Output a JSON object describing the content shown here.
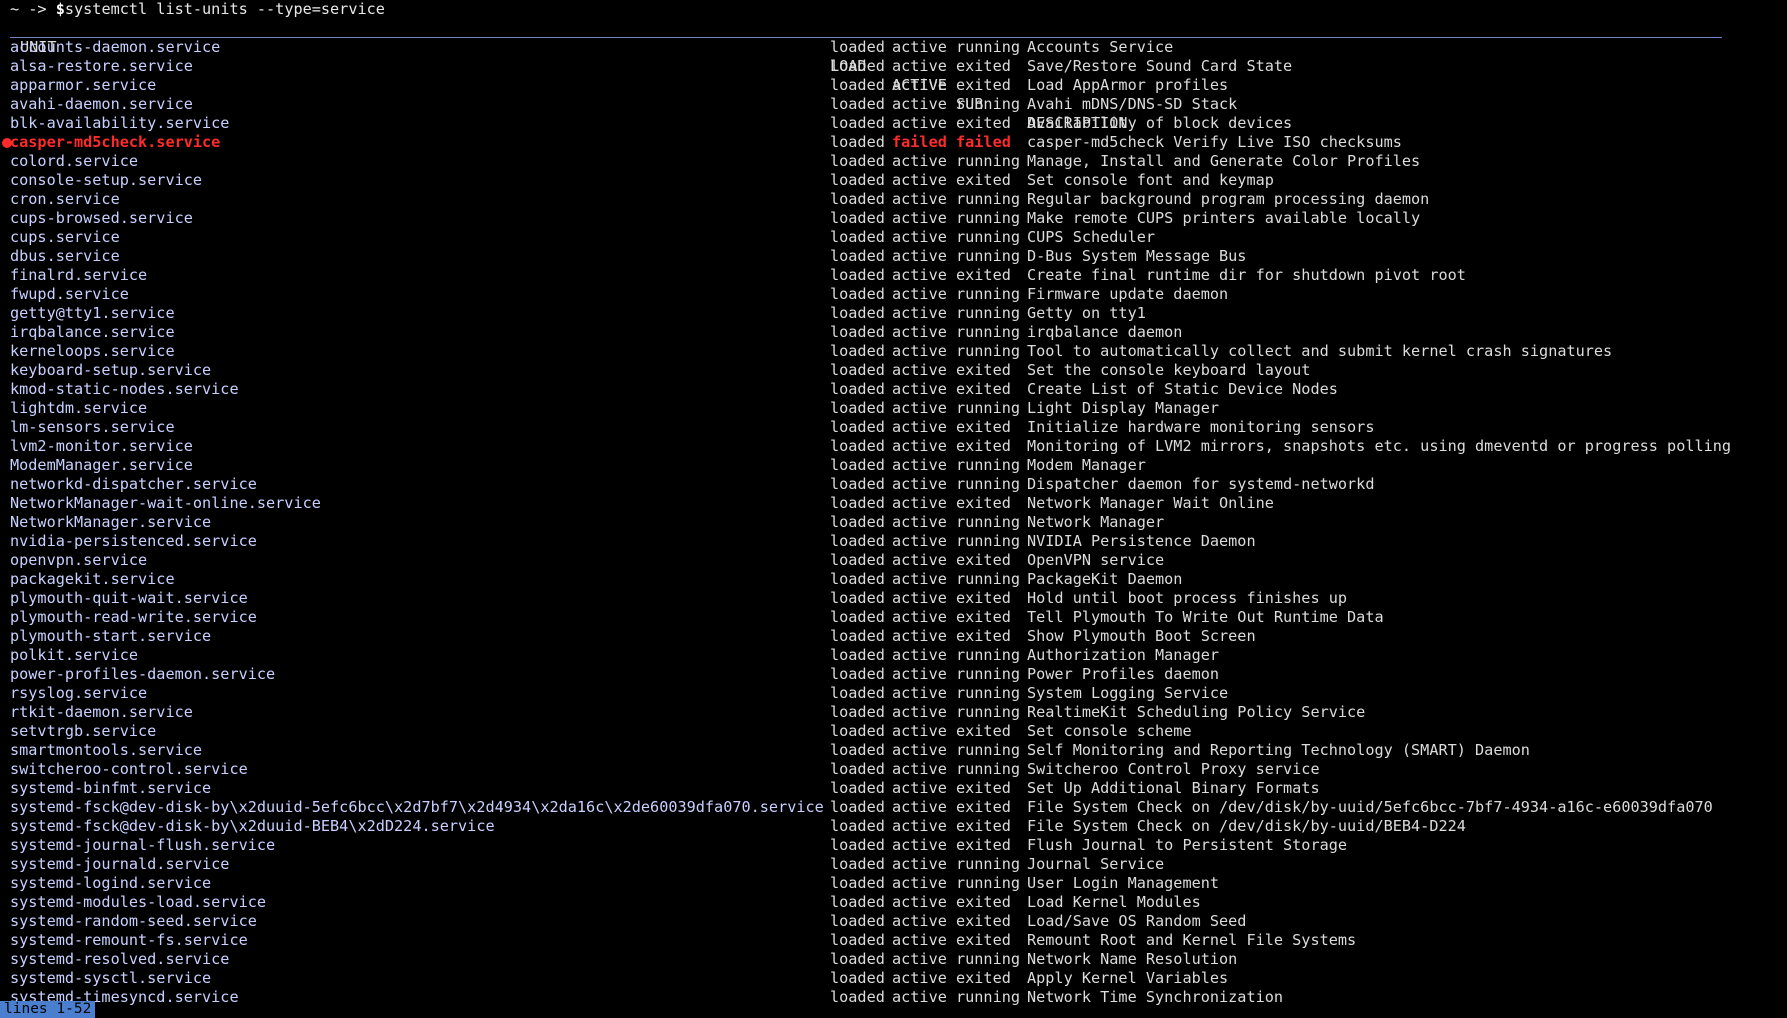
{
  "prompt": {
    "prefix": "~ -> ",
    "symbol": "$",
    "command": "systemctl list-units --type=service"
  },
  "columns": {
    "unit": "UNIT",
    "load": "LOAD",
    "active": "ACTIVE",
    "sub": "SUB",
    "description": "DESCRIPTION"
  },
  "rows": [
    {
      "unit": "accounts-daemon.service",
      "load": "loaded",
      "active": "active",
      "sub": "running",
      "description": "Accounts Service"
    },
    {
      "unit": "alsa-restore.service",
      "load": "loaded",
      "active": "active",
      "sub": "exited",
      "description": "Save/Restore Sound Card State"
    },
    {
      "unit": "apparmor.service",
      "load": "loaded",
      "active": "active",
      "sub": "exited",
      "description": "Load AppArmor profiles"
    },
    {
      "unit": "avahi-daemon.service",
      "load": "loaded",
      "active": "active",
      "sub": "running",
      "description": "Avahi mDNS/DNS-SD Stack"
    },
    {
      "unit": "blk-availability.service",
      "load": "loaded",
      "active": "active",
      "sub": "exited",
      "description": "Availability of block devices"
    },
    {
      "unit": "casper-md5check.service",
      "load": "loaded",
      "active": "failed",
      "sub": "failed",
      "description": "casper-md5check Verify Live ISO checksums",
      "failed": true
    },
    {
      "unit": "colord.service",
      "load": "loaded",
      "active": "active",
      "sub": "running",
      "description": "Manage, Install and Generate Color Profiles"
    },
    {
      "unit": "console-setup.service",
      "load": "loaded",
      "active": "active",
      "sub": "exited",
      "description": "Set console font and keymap"
    },
    {
      "unit": "cron.service",
      "load": "loaded",
      "active": "active",
      "sub": "running",
      "description": "Regular background program processing daemon"
    },
    {
      "unit": "cups-browsed.service",
      "load": "loaded",
      "active": "active",
      "sub": "running",
      "description": "Make remote CUPS printers available locally"
    },
    {
      "unit": "cups.service",
      "load": "loaded",
      "active": "active",
      "sub": "running",
      "description": "CUPS Scheduler"
    },
    {
      "unit": "dbus.service",
      "load": "loaded",
      "active": "active",
      "sub": "running",
      "description": "D-Bus System Message Bus"
    },
    {
      "unit": "finalrd.service",
      "load": "loaded",
      "active": "active",
      "sub": "exited",
      "description": "Create final runtime dir for shutdown pivot root"
    },
    {
      "unit": "fwupd.service",
      "load": "loaded",
      "active": "active",
      "sub": "running",
      "description": "Firmware update daemon"
    },
    {
      "unit": "getty@tty1.service",
      "load": "loaded",
      "active": "active",
      "sub": "running",
      "description": "Getty on tty1"
    },
    {
      "unit": "irqbalance.service",
      "load": "loaded",
      "active": "active",
      "sub": "running",
      "description": "irqbalance daemon"
    },
    {
      "unit": "kerneloops.service",
      "load": "loaded",
      "active": "active",
      "sub": "running",
      "description": "Tool to automatically collect and submit kernel crash signatures"
    },
    {
      "unit": "keyboard-setup.service",
      "load": "loaded",
      "active": "active",
      "sub": "exited",
      "description": "Set the console keyboard layout"
    },
    {
      "unit": "kmod-static-nodes.service",
      "load": "loaded",
      "active": "active",
      "sub": "exited",
      "description": "Create List of Static Device Nodes"
    },
    {
      "unit": "lightdm.service",
      "load": "loaded",
      "active": "active",
      "sub": "running",
      "description": "Light Display Manager"
    },
    {
      "unit": "lm-sensors.service",
      "load": "loaded",
      "active": "active",
      "sub": "exited",
      "description": "Initialize hardware monitoring sensors"
    },
    {
      "unit": "lvm2-monitor.service",
      "load": "loaded",
      "active": "active",
      "sub": "exited",
      "description": "Monitoring of LVM2 mirrors, snapshots etc. using dmeventd or progress polling"
    },
    {
      "unit": "ModemManager.service",
      "load": "loaded",
      "active": "active",
      "sub": "running",
      "description": "Modem Manager"
    },
    {
      "unit": "networkd-dispatcher.service",
      "load": "loaded",
      "active": "active",
      "sub": "running",
      "description": "Dispatcher daemon for systemd-networkd"
    },
    {
      "unit": "NetworkManager-wait-online.service",
      "load": "loaded",
      "active": "active",
      "sub": "exited",
      "description": "Network Manager Wait Online"
    },
    {
      "unit": "NetworkManager.service",
      "load": "loaded",
      "active": "active",
      "sub": "running",
      "description": "Network Manager"
    },
    {
      "unit": "nvidia-persistenced.service",
      "load": "loaded",
      "active": "active",
      "sub": "running",
      "description": "NVIDIA Persistence Daemon"
    },
    {
      "unit": "openvpn.service",
      "load": "loaded",
      "active": "active",
      "sub": "exited",
      "description": "OpenVPN service"
    },
    {
      "unit": "packagekit.service",
      "load": "loaded",
      "active": "active",
      "sub": "running",
      "description": "PackageKit Daemon"
    },
    {
      "unit": "plymouth-quit-wait.service",
      "load": "loaded",
      "active": "active",
      "sub": "exited",
      "description": "Hold until boot process finishes up"
    },
    {
      "unit": "plymouth-read-write.service",
      "load": "loaded",
      "active": "active",
      "sub": "exited",
      "description": "Tell Plymouth To Write Out Runtime Data"
    },
    {
      "unit": "plymouth-start.service",
      "load": "loaded",
      "active": "active",
      "sub": "exited",
      "description": "Show Plymouth Boot Screen"
    },
    {
      "unit": "polkit.service",
      "load": "loaded",
      "active": "active",
      "sub": "running",
      "description": "Authorization Manager"
    },
    {
      "unit": "power-profiles-daemon.service",
      "load": "loaded",
      "active": "active",
      "sub": "running",
      "description": "Power Profiles daemon"
    },
    {
      "unit": "rsyslog.service",
      "load": "loaded",
      "active": "active",
      "sub": "running",
      "description": "System Logging Service"
    },
    {
      "unit": "rtkit-daemon.service",
      "load": "loaded",
      "active": "active",
      "sub": "running",
      "description": "RealtimeKit Scheduling Policy Service"
    },
    {
      "unit": "setvtrgb.service",
      "load": "loaded",
      "active": "active",
      "sub": "exited",
      "description": "Set console scheme"
    },
    {
      "unit": "smartmontools.service",
      "load": "loaded",
      "active": "active",
      "sub": "running",
      "description": "Self Monitoring and Reporting Technology (SMART) Daemon"
    },
    {
      "unit": "switcheroo-control.service",
      "load": "loaded",
      "active": "active",
      "sub": "running",
      "description": "Switcheroo Control Proxy service"
    },
    {
      "unit": "systemd-binfmt.service",
      "load": "loaded",
      "active": "active",
      "sub": "exited",
      "description": "Set Up Additional Binary Formats"
    },
    {
      "unit": "systemd-fsck@dev-disk-by\\x2duuid-5efc6bcc\\x2d7bf7\\x2d4934\\x2da16c\\x2de60039dfa070.service",
      "load": "loaded",
      "active": "active",
      "sub": "exited",
      "description": "File System Check on /dev/disk/by-uuid/5efc6bcc-7bf7-4934-a16c-e60039dfa070"
    },
    {
      "unit": "systemd-fsck@dev-disk-by\\x2duuid-BEB4\\x2dD224.service",
      "load": "loaded",
      "active": "active",
      "sub": "exited",
      "description": "File System Check on /dev/disk/by-uuid/BEB4-D224"
    },
    {
      "unit": "systemd-journal-flush.service",
      "load": "loaded",
      "active": "active",
      "sub": "exited",
      "description": "Flush Journal to Persistent Storage"
    },
    {
      "unit": "systemd-journald.service",
      "load": "loaded",
      "active": "active",
      "sub": "running",
      "description": "Journal Service"
    },
    {
      "unit": "systemd-logind.service",
      "load": "loaded",
      "active": "active",
      "sub": "running",
      "description": "User Login Management"
    },
    {
      "unit": "systemd-modules-load.service",
      "load": "loaded",
      "active": "active",
      "sub": "exited",
      "description": "Load Kernel Modules"
    },
    {
      "unit": "systemd-random-seed.service",
      "load": "loaded",
      "active": "active",
      "sub": "exited",
      "description": "Load/Save OS Random Seed"
    },
    {
      "unit": "systemd-remount-fs.service",
      "load": "loaded",
      "active": "active",
      "sub": "exited",
      "description": "Remount Root and Kernel File Systems"
    },
    {
      "unit": "systemd-resolved.service",
      "load": "loaded",
      "active": "active",
      "sub": "running",
      "description": "Network Name Resolution"
    },
    {
      "unit": "systemd-sysctl.service",
      "load": "loaded",
      "active": "active",
      "sub": "exited",
      "description": "Apply Kernel Variables"
    },
    {
      "unit": "systemd-timesyncd.service",
      "load": "loaded",
      "active": "active",
      "sub": "running",
      "description": "Network Time Synchronization"
    }
  ],
  "status_bar": "lines 1-52",
  "colors": {
    "background": "#000000",
    "text": "#dcdcdc",
    "unit_name": "#c8d0ff",
    "failed": "#ff2a2a",
    "status_bar": "#4a7fd0"
  }
}
